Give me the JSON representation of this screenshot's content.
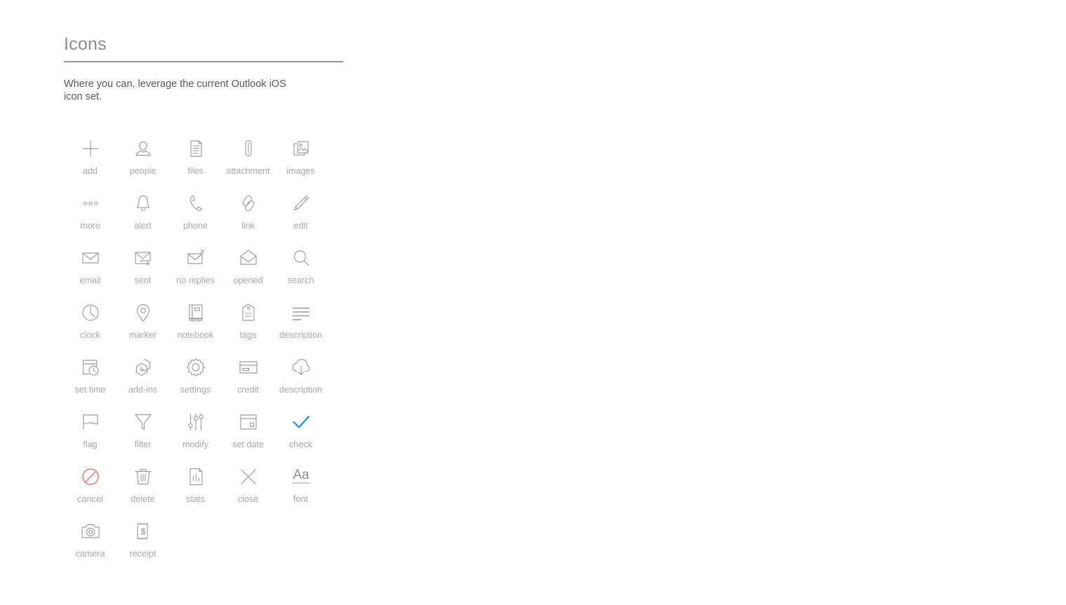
{
  "header": {
    "title": "Icons"
  },
  "intro": {
    "text": "Where you can, leverage the current Outlook iOS icon set."
  },
  "colors": {
    "title": "#8c8c8c",
    "rule": "#9a9a9a",
    "body_text": "#59595b",
    "icon_stroke": "#9d9d9d",
    "icon_label": "#a9a9a9",
    "cancel_red": "#e8605e",
    "check_blue": "#1b8ad6",
    "background": "#ffffff"
  },
  "icon_grid": {
    "columns": 5,
    "items": [
      {
        "icon": "add-icon",
        "label": "add"
      },
      {
        "icon": "people-icon",
        "label": "people"
      },
      {
        "icon": "files-icon",
        "label": "files"
      },
      {
        "icon": "attachment-icon",
        "label": "attachment"
      },
      {
        "icon": "images-icon",
        "label": "images"
      },
      {
        "icon": "more-icon",
        "label": "more"
      },
      {
        "icon": "alert-icon",
        "label": "alert"
      },
      {
        "icon": "phone-icon",
        "label": "phone"
      },
      {
        "icon": "link-icon",
        "label": "link"
      },
      {
        "icon": "edit-icon",
        "label": "edit"
      },
      {
        "icon": "email-icon",
        "label": "email"
      },
      {
        "icon": "sent-icon",
        "label": "sent"
      },
      {
        "icon": "no-replies-icon",
        "label": "no replies"
      },
      {
        "icon": "opened-icon",
        "label": "opened"
      },
      {
        "icon": "search-icon",
        "label": "search"
      },
      {
        "icon": "clock-icon",
        "label": "clock"
      },
      {
        "icon": "marker-icon",
        "label": "marker"
      },
      {
        "icon": "notebook-icon",
        "label": "notebook"
      },
      {
        "icon": "tags-icon",
        "label": "tags"
      },
      {
        "icon": "description-lines-icon",
        "label": "description"
      },
      {
        "icon": "set-time-icon",
        "label": "set time"
      },
      {
        "icon": "add-ins-icon",
        "label": "add-ins"
      },
      {
        "icon": "settings-icon",
        "label": "settings"
      },
      {
        "icon": "credit-icon",
        "label": "credit"
      },
      {
        "icon": "description-cloud-icon",
        "label": "description"
      },
      {
        "icon": "flag-icon",
        "label": "flag"
      },
      {
        "icon": "filter-icon",
        "label": "filter"
      },
      {
        "icon": "modify-icon",
        "label": "modify"
      },
      {
        "icon": "set-date-icon",
        "label": "set date"
      },
      {
        "icon": "check-icon",
        "label": "check"
      },
      {
        "icon": "cancel-icon",
        "label": "cancel"
      },
      {
        "icon": "delete-icon",
        "label": "delete"
      },
      {
        "icon": "stats-icon",
        "label": "stats"
      },
      {
        "icon": "close-icon",
        "label": "close"
      },
      {
        "icon": "font-icon",
        "label": "font"
      },
      {
        "icon": "camera-icon",
        "label": "camera"
      },
      {
        "icon": "receipt-icon",
        "label": "receipt"
      }
    ]
  },
  "font_icon_text": "Aa",
  "receipt_icon_text": "$"
}
